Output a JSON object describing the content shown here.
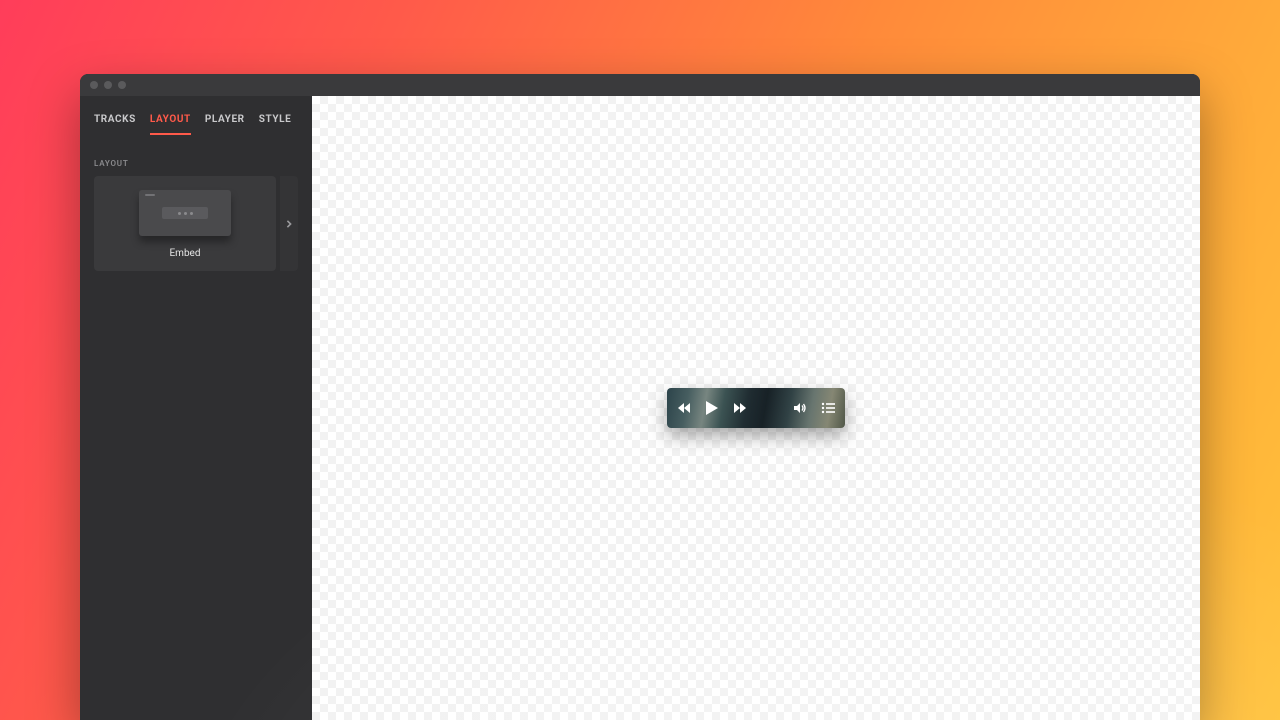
{
  "tabs": {
    "tracks": "TRACKS",
    "layout": "LAYOUT",
    "player": "PLAYER",
    "style": "STYLE",
    "active": "layout"
  },
  "sidebar": {
    "sectionLabel": "LAYOUT",
    "cards": [
      {
        "label": "Embed"
      }
    ]
  }
}
